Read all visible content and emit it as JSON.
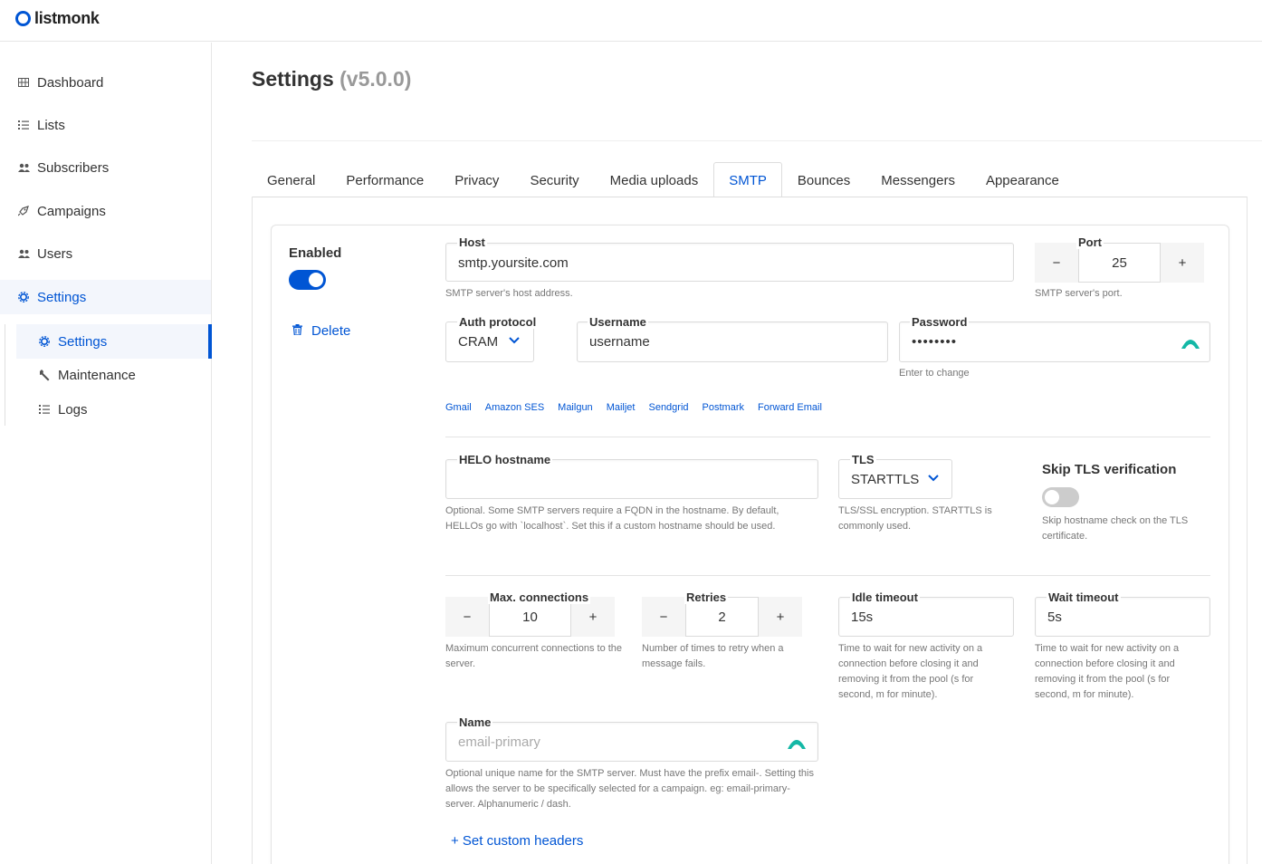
{
  "app": {
    "logo_text": "listmonk",
    "brand_color": "#0055d4"
  },
  "sidebar": {
    "items": [
      {
        "label": "Dashboard",
        "icon": "dashboard-icon"
      },
      {
        "label": "Lists",
        "icon": "list-icon"
      },
      {
        "label": "Subscribers",
        "icon": "users-icon"
      },
      {
        "label": "Campaigns",
        "icon": "rocket-icon"
      },
      {
        "label": "Users",
        "icon": "users-icon"
      },
      {
        "label": "Settings",
        "icon": "gear-icon",
        "active": true
      }
    ],
    "sub_items": [
      {
        "label": "Settings",
        "icon": "gear-icon",
        "active": true
      },
      {
        "label": "Maintenance",
        "icon": "wrench-icon"
      },
      {
        "label": "Logs",
        "icon": "list-icon"
      }
    ]
  },
  "page": {
    "title": "Settings",
    "version": "(v5.0.0)"
  },
  "tabs": [
    "General",
    "Performance",
    "Privacy",
    "Security",
    "Media uploads",
    "SMTP",
    "Bounces",
    "Messengers",
    "Appearance"
  ],
  "active_tab": "SMTP",
  "smtp": {
    "enabled_label": "Enabled",
    "enabled": true,
    "delete_label": "Delete",
    "host": {
      "label": "Host",
      "value": "smtp.yoursite.com",
      "help": "SMTP server's host address."
    },
    "port": {
      "label": "Port",
      "value": "25",
      "help": "SMTP server's port.",
      "minus": "−",
      "plus": "+"
    },
    "auth_protocol": {
      "label": "Auth protocol",
      "value": "CRAM"
    },
    "username": {
      "label": "Username",
      "value": "username"
    },
    "password": {
      "label": "Password",
      "value": "••••••••",
      "help": "Enter to change"
    },
    "presets": [
      "Gmail",
      "Amazon SES",
      "Mailgun",
      "Mailjet",
      "Sendgrid",
      "Postmark",
      "Forward Email"
    ],
    "helo": {
      "label": "HELO hostname",
      "value": "",
      "help": "Optional. Some SMTP servers require a FQDN in the hostname. By default, HELLOs go with `localhost`. Set this if a custom hostname should be used."
    },
    "tls": {
      "label": "TLS",
      "value": "STARTTLS",
      "help": "TLS/SSL encryption. STARTTLS is commonly used."
    },
    "skip_tls": {
      "label": "Skip TLS verification",
      "enabled": false,
      "help": "Skip hostname check on the TLS certificate."
    },
    "max_connections": {
      "label": "Max. connections",
      "value": "10",
      "help": "Maximum concurrent connections to the server."
    },
    "retries": {
      "label": "Retries",
      "value": "2",
      "help": "Number of times to retry when a message fails."
    },
    "idle_timeout": {
      "label": "Idle timeout",
      "value": "15s",
      "help": "Time to wait for new activity on a connection before closing it and removing it from the pool (s for second, m for minute)."
    },
    "wait_timeout": {
      "label": "Wait timeout",
      "value": "5s",
      "help": "Time to wait for new activity on a connection before closing it and removing it from the pool (s for second, m for minute)."
    },
    "name": {
      "label": "Name",
      "placeholder": "email-primary",
      "help": "Optional unique name for the SMTP server. Must have the prefix email-. Setting this allows the server to be specifically selected for a campaign. eg: email-primary-server. Alphanumeric / dash."
    },
    "custom_headers_label": "+ Set custom headers"
  }
}
